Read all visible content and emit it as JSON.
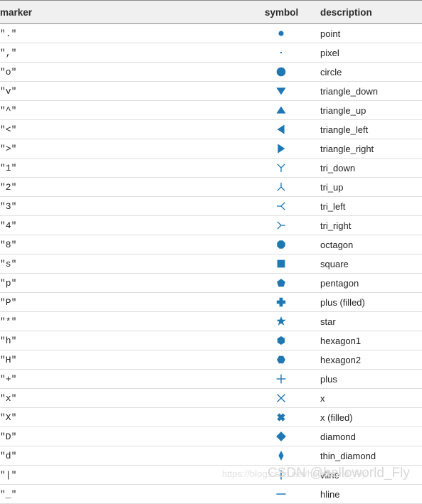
{
  "table": {
    "columns": [
      {
        "key": "marker",
        "label": "marker"
      },
      {
        "key": "symbol",
        "label": "symbol"
      },
      {
        "key": "description",
        "label": "description"
      }
    ],
    "rows": [
      {
        "marker": "\".\"",
        "symbol_icon": "point-marker-icon",
        "description": "point"
      },
      {
        "marker": "\",\"",
        "symbol_icon": "pixel-marker-icon",
        "description": "pixel"
      },
      {
        "marker": "\"o\"",
        "symbol_icon": "circle-marker-icon",
        "description": "circle"
      },
      {
        "marker": "\"v\"",
        "symbol_icon": "triangle-down-marker-icon",
        "description": "triangle_down"
      },
      {
        "marker": "\"^\"",
        "symbol_icon": "triangle-up-marker-icon",
        "description": "triangle_up"
      },
      {
        "marker": "\"<\"",
        "symbol_icon": "triangle-left-marker-icon",
        "description": "triangle_left"
      },
      {
        "marker": "\">\"",
        "symbol_icon": "triangle-right-marker-icon",
        "description": "triangle_right"
      },
      {
        "marker": "\"1\"",
        "symbol_icon": "tri-down-marker-icon",
        "description": "tri_down"
      },
      {
        "marker": "\"2\"",
        "symbol_icon": "tri-up-marker-icon",
        "description": "tri_up"
      },
      {
        "marker": "\"3\"",
        "symbol_icon": "tri-left-marker-icon",
        "description": "tri_left"
      },
      {
        "marker": "\"4\"",
        "symbol_icon": "tri-right-marker-icon",
        "description": "tri_right"
      },
      {
        "marker": "\"8\"",
        "symbol_icon": "octagon-marker-icon",
        "description": "octagon"
      },
      {
        "marker": "\"s\"",
        "symbol_icon": "square-marker-icon",
        "description": "square"
      },
      {
        "marker": "\"p\"",
        "symbol_icon": "pentagon-marker-icon",
        "description": "pentagon"
      },
      {
        "marker": "\"P\"",
        "symbol_icon": "plus-filled-marker-icon",
        "description": "plus (filled)"
      },
      {
        "marker": "\"*\"",
        "symbol_icon": "star-marker-icon",
        "description": "star"
      },
      {
        "marker": "\"h\"",
        "symbol_icon": "hexagon1-marker-icon",
        "description": "hexagon1"
      },
      {
        "marker": "\"H\"",
        "symbol_icon": "hexagon2-marker-icon",
        "description": "hexagon2"
      },
      {
        "marker": "\"+\"",
        "symbol_icon": "plus-marker-icon",
        "description": "plus"
      },
      {
        "marker": "\"x\"",
        "symbol_icon": "x-marker-icon",
        "description": "x"
      },
      {
        "marker": "\"X\"",
        "symbol_icon": "x-filled-marker-icon",
        "description": "x (filled)"
      },
      {
        "marker": "\"D\"",
        "symbol_icon": "diamond-marker-icon",
        "description": "diamond"
      },
      {
        "marker": "\"d\"",
        "symbol_icon": "thin-diamond-marker-icon",
        "description": "thin_diamond"
      },
      {
        "marker": "\"|\"",
        "symbol_icon": "vline-marker-icon",
        "description": "vline"
      },
      {
        "marker": "\"_\"",
        "symbol_icon": "hline-marker-icon",
        "description": "hline"
      }
    ]
  },
  "watermark": {
    "url": "https://blog.csdn.net/helloworld_Fly",
    "handle": "CSDN @helloworld_Fly"
  },
  "colors": {
    "marker_blue": "#1f77b4",
    "header_bg": "#f0f0f0",
    "header_border": "#8a8a8a",
    "row_border": "#dddddd",
    "text": "#222222"
  }
}
